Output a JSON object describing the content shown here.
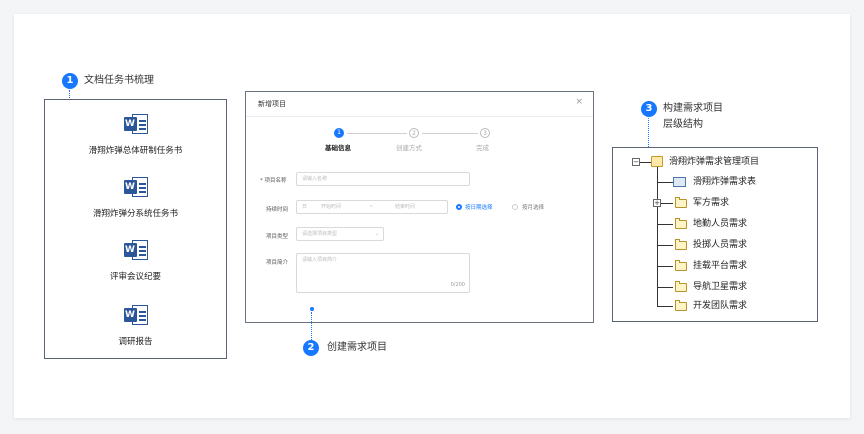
{
  "steps": [
    {
      "number": "1",
      "label": "文档任务书梳理"
    },
    {
      "number": "2",
      "label": "创建需求项目"
    },
    {
      "number": "3",
      "label": "构建需求项目",
      "label2": "层级结构"
    }
  ],
  "documents": [
    {
      "label": "滑翔炸弹总体研制任务书",
      "icon": "word-document-icon"
    },
    {
      "label": "滑翔炸弹分系统任务书",
      "icon": "word-document-icon"
    },
    {
      "label": "评审会议纪要",
      "icon": "word-document-icon"
    },
    {
      "label": "调研报告",
      "icon": "word-document-icon"
    }
  ],
  "dialog": {
    "title": "新增项目",
    "close": "×",
    "steps": [
      {
        "number": "1",
        "label": "基础信息"
      },
      {
        "number": "2",
        "label": "创建方式"
      },
      {
        "number": "3",
        "label": "完成"
      }
    ],
    "fields": {
      "name_label": "* 项目名称",
      "name_placeholder": "请输入名称",
      "time_label": "持续时间",
      "time_prefix": "日",
      "start_placeholder": "开始时间",
      "time_sep": "~",
      "end_placeholder": "结束时间",
      "radio_on": "按日期选择",
      "radio_off": "按月选择",
      "type_label": "项目类型",
      "type_placeholder": "请选择项目类型",
      "desc_label": "项目简介",
      "desc_placeholder": "请输入项目简介",
      "desc_count": "0/200"
    }
  },
  "tree": {
    "root": "滑翔炸弹需求管理项目",
    "table_item": "滑翔炸弹需求表",
    "children": [
      "军方需求",
      "地勤人员需求",
      "投掷人员需求",
      "挂载平台需求",
      "导航卫星需求",
      "开发团队需求"
    ]
  },
  "colors": {
    "accent": "#1677ff",
    "word": "#2b579a",
    "border": "#5b6475"
  }
}
